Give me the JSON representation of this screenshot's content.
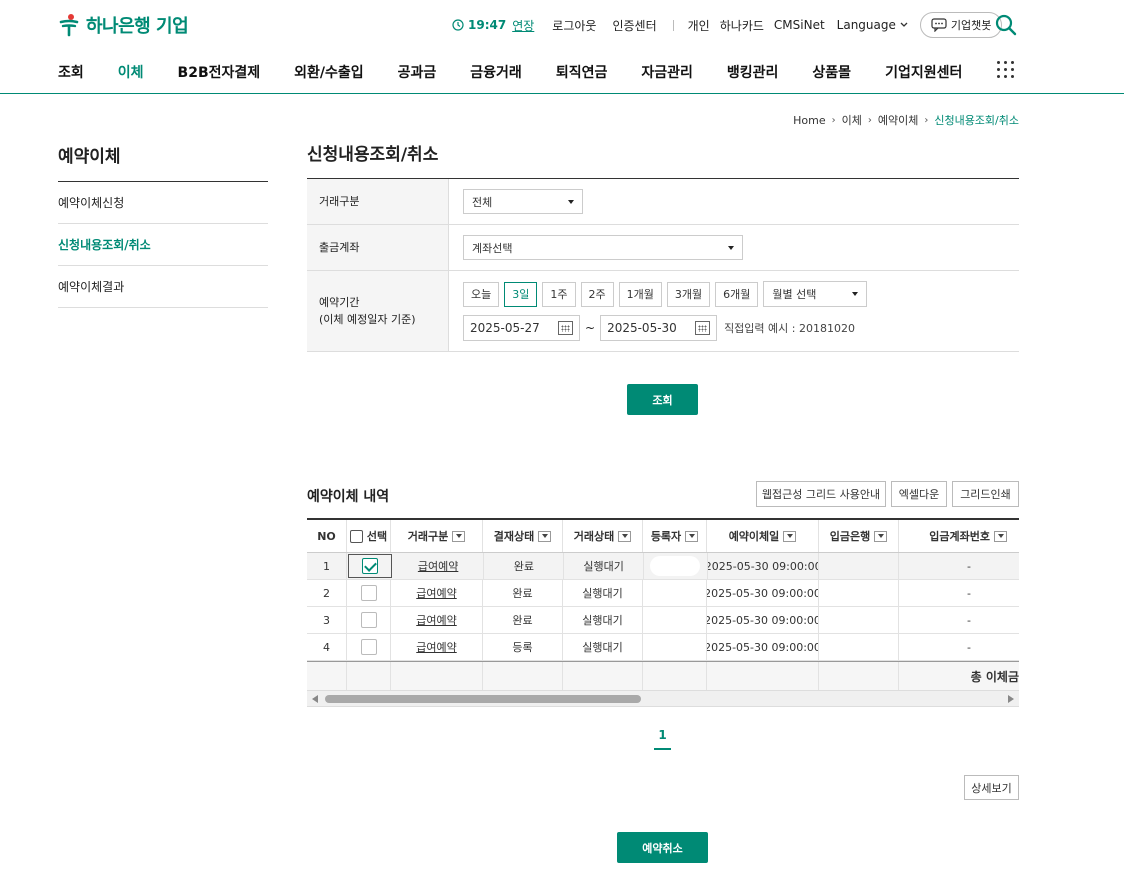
{
  "brand": {
    "name": "하나은행 기업",
    "color": "#008a75"
  },
  "util": {
    "time": "19:47",
    "extend": "연장",
    "logout": "로그아웃",
    "cert": "인증센터",
    "personal": "개인",
    "card": "하나카드",
    "cmsinet": "CMSiNet",
    "language": "Language",
    "chatbot": "기업챗봇"
  },
  "gnb": [
    "조회",
    "이체",
    "B2B전자결제",
    "외환/수출입",
    "공과금",
    "금융거래",
    "퇴직연금",
    "자금관리",
    "뱅킹관리",
    "상품몰",
    "기업지원센터"
  ],
  "breadcrumb": [
    "Home",
    "이체",
    "예약이체",
    "신청내용조회/취소"
  ],
  "lnb": {
    "title": "예약이체",
    "items": [
      "예약이체신청",
      "신청내용조회/취소",
      "예약이체결과"
    ]
  },
  "page_title": "신청내용조회/취소",
  "form": {
    "type_label": "거래구분",
    "type_value": "전체",
    "account_label": "출금계좌",
    "account_value": "계좌선택",
    "period_label": "예약기간",
    "period_sub": "(이체 예정일자 기준)",
    "period_buttons": [
      "오늘",
      "3일",
      "1주",
      "2주",
      "1개월",
      "3개월",
      "6개월"
    ],
    "month_select": "월별 선택",
    "date_from": "2025-05-27",
    "date_to": "2025-05-30",
    "tilde": "~",
    "hint": "직접입력 예시 : 20181020",
    "search_btn": "조회"
  },
  "grid": {
    "title": "예약이체 내역",
    "buttons": [
      "웹접근성 그리드 사용안내",
      "엑셀다운",
      "그리드인쇄"
    ],
    "headers": [
      "NO",
      "선택",
      "거래구분",
      "결재상태",
      "거래상태",
      "등록자",
      "예약이체일",
      "입금은행",
      "입금계좌번호"
    ],
    "rows": [
      {
        "no": "1",
        "type": "급여예약",
        "approval": "완료",
        "status": "실행대기",
        "registrant": "",
        "date": "2025-05-30 09:00:00",
        "bank": "",
        "account": "-"
      },
      {
        "no": "2",
        "type": "급여예약",
        "approval": "완료",
        "status": "실행대기",
        "registrant": "",
        "date": "2025-05-30 09:00:00",
        "bank": "",
        "account": "-"
      },
      {
        "no": "3",
        "type": "급여예약",
        "approval": "완료",
        "status": "실행대기",
        "registrant": "",
        "date": "2025-05-30 09:00:00",
        "bank": "",
        "account": "-"
      },
      {
        "no": "4",
        "type": "급여예약",
        "approval": "등록",
        "status": "실행대기",
        "registrant": "",
        "date": "2025-05-30 09:00:00",
        "bank": "",
        "account": "-"
      }
    ],
    "total_label": "총 이체금"
  },
  "pager": {
    "current": "1"
  },
  "detail_btn": "상세보기",
  "cancel_btn": "예약취소"
}
